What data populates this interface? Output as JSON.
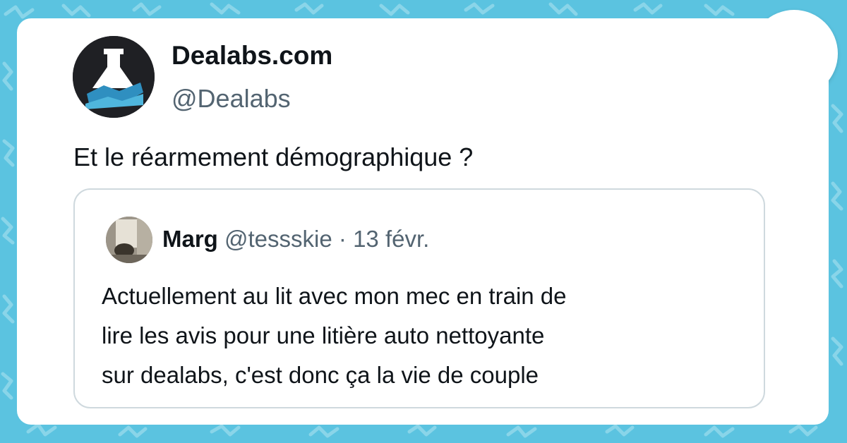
{
  "colors": {
    "background": "#5bc3e0",
    "card": "#ffffff",
    "text_primary": "#0f1419",
    "text_secondary": "#536471",
    "quote_border": "#cfd9de"
  },
  "tweet": {
    "display_name": "Dealabs.com",
    "handle": "@Dealabs",
    "text": "Et le réarmement démographique ?",
    "avatar_icon": "dealabs-flask-logo-icon"
  },
  "quote": {
    "display_name": "Marg",
    "handle": "@tessskie",
    "separator": "·",
    "date": "13 févr.",
    "avatar_icon": "user-photo-avatar",
    "lines": [
      "Actuellement au lit avec mon mec en train de",
      "lire les avis pour une litière auto nettoyante",
      "sur dealabs, c'est donc ça la vie de couple"
    ]
  },
  "brand_badge": {
    "icon": "crown-logo-icon"
  }
}
